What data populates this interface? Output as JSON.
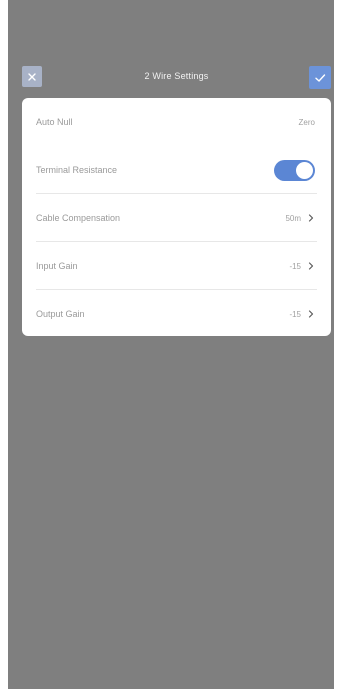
{
  "header": {
    "title": "2 Wire Settings",
    "close_icon": "close-icon",
    "confirm_icon": "checkmark-icon"
  },
  "colors": {
    "overlay": "#7f7f7f",
    "accent": "#5b86d4",
    "close_button": "#a8b2c7",
    "confirm_button": "#6c93d9"
  },
  "settings": {
    "auto_null": {
      "label": "Auto Null",
      "value": "Zero"
    },
    "terminal_resistance": {
      "label": "Terminal Resistance",
      "enabled": true
    },
    "cable_compensation": {
      "label": "Cable Compensation",
      "value": "50m"
    },
    "input_gain": {
      "label": "Input Gain",
      "value": "-15"
    },
    "output_gain": {
      "label": "Output Gain",
      "value": "-15"
    }
  }
}
